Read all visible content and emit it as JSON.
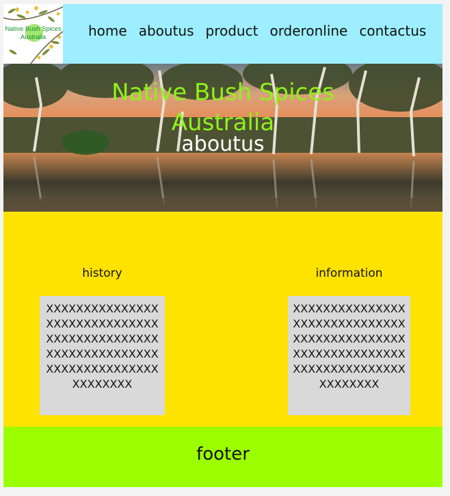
{
  "header": {
    "logo_text": "Native Bush Spices Australia",
    "nav": [
      "home",
      "aboutus",
      "product",
      "orderonline",
      "contactus"
    ]
  },
  "hero": {
    "title_line1": "Native Bush Spices",
    "title_line2": "Australia",
    "subtitle": "aboutus"
  },
  "content": {
    "history": {
      "heading": "history",
      "text": "XXXXXXXXXXXXXXXXXXXXXXXXXXXXXXXXXXXXXXXXXXXXXXXXXXXXXXXXXXXXXXXXXXXXXXXXXXXXXXXXXXX"
    },
    "information": {
      "heading": "information",
      "text": "XXXXXXXXXXXXXXXXXXXXXXXXXXXXXXXXXXXXXXXXXXXXXXXXXXXXXXXXXXXXXXXXXXXXXXXXXXXXXXXXXXX"
    }
  },
  "footer": {
    "text": "footer"
  },
  "colors": {
    "header_bg": "#9deefe",
    "content_bg": "#fee200",
    "footer_bg": "#9cff00",
    "box_bg": "#d9d9d9",
    "hero_title": "#8ff21a"
  }
}
